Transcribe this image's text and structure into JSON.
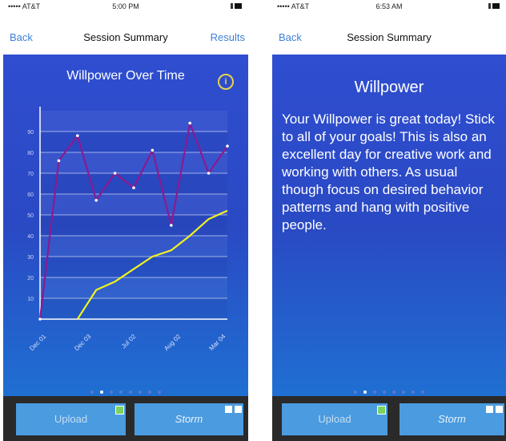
{
  "left_screen": {
    "status": {
      "signal": "••••• AT&T",
      "time": "5:00 PM"
    },
    "nav": {
      "back": "Back",
      "title": "Session Summary",
      "right": "Results"
    },
    "chart": {
      "title": "Willpower Over Time",
      "info_icon": "info-icon"
    },
    "buttons": {
      "upload": "Upload",
      "storm": "Storm"
    }
  },
  "right_screen": {
    "status": {
      "signal": "••••• AT&T",
      "time": "6:53 AM"
    },
    "nav": {
      "back": "Back",
      "title": "Session Summary"
    },
    "heading": "Willpower",
    "body": "Your Willpower is great today! Stick to all of your goals! This is also an excellent day for creative work and working with others. As usual though focus on desired behavior patterns and hang with positive people.",
    "buttons": {
      "upload": "Upload",
      "storm": "Storm"
    }
  },
  "chart_data": {
    "type": "line",
    "title": "Willpower Over Time",
    "y_ticks": [
      "10",
      "20",
      "30",
      "40",
      "50",
      "60",
      "70",
      "80",
      "90"
    ],
    "ylim": [
      0,
      100
    ],
    "x_ticks": [
      "Dec 01",
      "Dec 03",
      "Jul 02",
      "Aug 02",
      "Mar 04"
    ],
    "series": [
      {
        "name": "",
        "color": "#8b1a8f",
        "values": [
          0,
          76,
          88,
          57,
          70,
          63,
          81,
          45,
          94,
          70,
          83
        ]
      },
      {
        "name": "",
        "color": "#f1f21f",
        "values": [
          null,
          null,
          -5,
          14,
          18,
          24,
          30,
          33,
          40,
          48,
          52
        ]
      }
    ]
  },
  "pagination": {
    "count": 8,
    "active": 1
  }
}
